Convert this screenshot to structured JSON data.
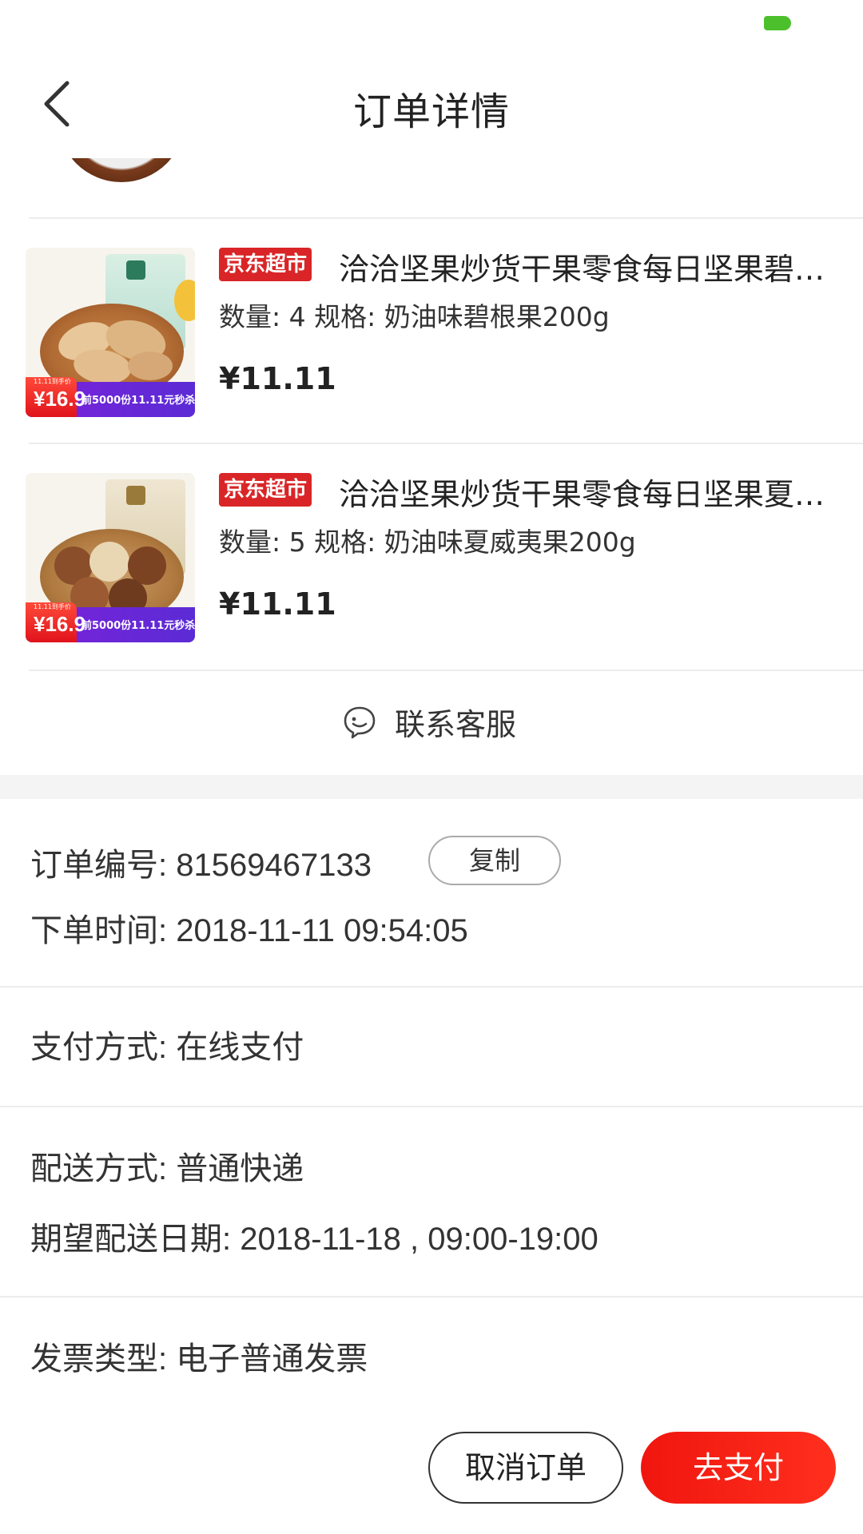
{
  "header": {
    "title": "订单详情",
    "back_icon": "chevron-left-icon"
  },
  "status_bar": {
    "battery_color": "#4cc02c"
  },
  "products": [
    {
      "badge": "京东超市",
      "title": "洽洽坚果炒货干果零食每日坚果碧根果",
      "spec": "数量: 4 规格: 奶油味碧根果200g",
      "price": "¥11.11",
      "promo_tag": "11.11到手价",
      "promo_price": "¥16.9",
      "promo_text": "前5000份11.11元秒杀"
    },
    {
      "badge": "京东超市",
      "title": "洽洽坚果炒货干果零食每日坚果夏威夷果",
      "spec": "数量: 5 规格: 奶油味夏威夷果200g",
      "price": "¥11.11",
      "promo_tag": "11.11到手价",
      "promo_price": "¥16.9",
      "promo_text": "前5000份11.11元秒杀"
    }
  ],
  "service": {
    "label": "联系客服",
    "icon": "chat-face-icon"
  },
  "order": {
    "number_label": "订单编号: ",
    "number": "81569467133",
    "copy_label": "复制",
    "time_label": "下单时间: ",
    "time": "2018-11-11 09:54:05",
    "payment_label": "支付方式: ",
    "payment": "在线支付",
    "delivery_label": "配送方式: ",
    "delivery": "普通快递",
    "expected_label": "期望配送日期: ",
    "expected": "2018-11-18 , 09:00-19:00",
    "invoice_label": "发票类型: ",
    "invoice": "电子普通发票"
  },
  "actions": {
    "cancel_label": "取消订单",
    "pay_label": "去支付"
  },
  "colors": {
    "accent": "#f0160f",
    "badge": "#d92527"
  }
}
